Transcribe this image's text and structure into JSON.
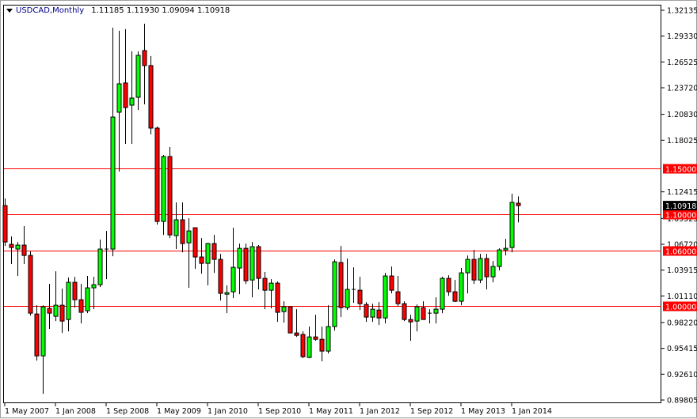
{
  "header": {
    "symbol": "USDCAD,Monthly",
    "open": "1.11185",
    "high": "1.11930",
    "low": "1.09094",
    "close": "1.10918"
  },
  "chart_data": {
    "type": "candlestick",
    "title": "USDCAD,Monthly",
    "first_month": "May 2007",
    "last_month": "Feb 2014",
    "ylim": [
      0.89805,
      1.32135
    ],
    "y_ticks": [
      "1.32135",
      "1.29330",
      "1.26525",
      "1.23720",
      "1.20830",
      "1.18025",
      "1.12415",
      "1.09525",
      "1.06720",
      "1.03915",
      "1.01110",
      "0.98220",
      "0.95415",
      "0.92610",
      "0.89805"
    ],
    "x_ticks": [
      "1 May 2007",
      "1 Jan 2008",
      "1 Sep 2008",
      "1 May 2009",
      "1 Jan 2010",
      "1 Sep 2010",
      "1 May 2011",
      "1 Jan 2012",
      "1 Sep 2012",
      "1 May 2013",
      "1 Jan 2014"
    ],
    "x_tick_every_months": 8,
    "horizontal_lines": [
      {
        "value": 1.15,
        "label": "1.15000"
      },
      {
        "value": 1.1,
        "label": "1.10000"
      },
      {
        "value": 1.06,
        "label": "1.06000"
      },
      {
        "value": 1.0,
        "label": "1.00000"
      }
    ],
    "current_price": {
      "value": 1.10918,
      "label": "1.10918"
    },
    "colors": {
      "up": "#00ff00",
      "down": "#ff0000",
      "line": "#ff0000",
      "outline": "#000000",
      "current": "#000000"
    },
    "ohlc": [
      [
        1.1092,
        1.1169,
        1.0654,
        1.0697
      ],
      [
        1.0671,
        1.0757,
        1.0457,
        1.0637
      ],
      [
        1.062,
        1.0697,
        1.0328,
        1.0663
      ],
      [
        1.0663,
        1.0869,
        1.0457,
        1.0551
      ],
      [
        1.0551,
        1.0594,
        0.9898,
        0.9924
      ],
      [
        0.9915,
        1.001,
        0.9409,
        0.946
      ],
      [
        0.946,
        1.001,
        0.9048,
        0.9993
      ],
      [
        0.9975,
        1.0242,
        0.9752,
        0.9924
      ],
      [
        0.989,
        1.0379,
        0.9838,
        1.001
      ],
      [
        1.001,
        1.019,
        0.9709,
        0.9838
      ],
      [
        0.9855,
        1.031,
        0.9726,
        1.0259
      ],
      [
        1.0259,
        1.0319,
        0.9984,
        1.007
      ],
      [
        1.007,
        1.0242,
        0.9812,
        0.9933
      ],
      [
        0.995,
        1.0328,
        0.9924,
        1.0199
      ],
      [
        1.0199,
        1.0319,
        0.9967,
        1.0233
      ],
      [
        1.0233,
        1.0723,
        1.0207,
        1.062
      ],
      [
        1.062,
        1.0817,
        1.0293,
        1.062
      ],
      [
        1.062,
        1.3025,
        1.0542,
        1.2054
      ],
      [
        1.2106,
        1.2991,
        1.1462,
        1.2415
      ],
      [
        1.2424,
        1.3008,
        1.1762,
        1.2157
      ],
      [
        1.2183,
        1.2767,
        1.1762,
        1.226
      ],
      [
        1.2269,
        1.2767,
        1.2132,
        1.2724
      ],
      [
        1.2776,
        1.3068,
        1.2192,
        1.2613
      ],
      [
        1.2613,
        1.2716,
        1.1865,
        1.1934
      ],
      [
        1.1934,
        1.1951,
        1.0886,
        1.092
      ],
      [
        1.092,
        1.1642,
        1.0774,
        1.1625
      ],
      [
        1.1625,
        1.1728,
        1.074,
        1.0774
      ],
      [
        1.0766,
        1.1127,
        1.062,
        1.0938
      ],
      [
        1.0938,
        1.1127,
        1.0585,
        1.068
      ],
      [
        1.0688,
        1.0955,
        1.0199,
        1.0817
      ],
      [
        1.0852,
        1.0852,
        1.0405,
        1.0534
      ],
      [
        1.0534,
        1.074,
        1.0353,
        1.0465
      ],
      [
        1.0465,
        1.0688,
        1.0225,
        1.068
      ],
      [
        1.068,
        1.0774,
        1.0362,
        1.0508
      ],
      [
        1.0508,
        1.0568,
        1.0061,
        1.0139
      ],
      [
        1.013,
        1.0225,
        0.9924,
        1.0147
      ],
      [
        1.0156,
        1.0852,
        1.0087,
        1.0422
      ],
      [
        1.0414,
        1.068,
        1.013,
        1.0628
      ],
      [
        1.0628,
        1.068,
        1.0242,
        1.0276
      ],
      [
        1.0284,
        1.0697,
        1.0096,
        1.0646
      ],
      [
        1.0646,
        1.0663,
        1.0182,
        1.0302
      ],
      [
        1.0302,
        1.0371,
        0.9967,
        1.0173
      ],
      [
        1.0173,
        1.0293,
        0.9975,
        1.025
      ],
      [
        1.025,
        1.0268,
        0.9829,
        0.9933
      ],
      [
        0.9941,
        1.0053,
        0.9821,
        0.9993
      ],
      [
        0.9993,
        0.9993,
        0.9709,
        0.9709
      ],
      [
        0.9709,
        0.9967,
        0.9666,
        0.9683
      ],
      [
        0.9692,
        0.9726,
        0.9434,
        0.9451
      ],
      [
        0.9443,
        0.9778,
        0.9434,
        0.9666
      ],
      [
        0.9666,
        0.9907,
        0.9623,
        0.964
      ],
      [
        0.964,
        0.9778,
        0.94,
        0.9512
      ],
      [
        0.9512,
        1.001,
        0.9486,
        0.9778
      ],
      [
        0.9778,
        1.0508,
        0.9735,
        1.0482
      ],
      [
        1.0474,
        1.0654,
        0.9881,
        0.9984
      ],
      [
        0.9984,
        1.0517,
        0.9958,
        1.0182
      ],
      [
        1.0182,
        1.0422,
        1.0036,
        1.0182
      ],
      [
        1.0173,
        1.0319,
        0.9958,
        1.0027
      ],
      [
        1.0018,
        1.0044,
        0.9829,
        0.9881
      ],
      [
        0.9881,
        1.0027,
        0.9829,
        0.9967
      ],
      [
        0.9958,
        1.0044,
        0.9795,
        0.9872
      ],
      [
        0.9872,
        1.0362,
        0.9812,
        1.0328
      ],
      [
        1.0328,
        1.0431,
        1.0139,
        1.0173
      ],
      [
        1.0156,
        1.0328,
        1.0001,
        1.0027
      ],
      [
        1.0027,
        1.0053,
        0.9838,
        0.9855
      ],
      [
        0.9855,
        0.9907,
        0.9623,
        0.9829
      ],
      [
        0.9838,
        1.0018,
        0.9726,
        0.9993
      ],
      [
        0.9984,
        1.0053,
        0.9855,
        0.9855
      ],
      [
        0.9924,
        0.9967,
        0.9812,
        0.9924
      ],
      [
        0.9924,
        1.0096,
        0.9812,
        0.9967
      ],
      [
        0.9967,
        1.0319,
        0.9924,
        1.0302
      ],
      [
        1.0302,
        1.0336,
        1.0113,
        1.0156
      ],
      [
        1.0156,
        1.0284,
        1.0044,
        1.0053
      ],
      [
        1.0053,
        1.0414,
        1.001,
        1.0362
      ],
      [
        1.0362,
        1.0551,
        1.0139,
        1.0508
      ],
      [
        1.0508,
        1.0611,
        1.0242,
        1.0284
      ],
      [
        1.0284,
        1.0568,
        1.025,
        1.0517
      ],
      [
        1.0517,
        1.0568,
        1.0182,
        1.0319
      ],
      [
        1.0319,
        1.0491,
        1.0259,
        1.0431
      ],
      [
        1.0431,
        1.0628,
        1.0388,
        1.0611
      ],
      [
        1.0611,
        1.0731,
        1.0551,
        1.0628
      ],
      [
        1.0637,
        1.1221,
        1.0585,
        1.1127
      ],
      [
        1.11185,
        1.1193,
        1.09094,
        1.10918
      ]
    ]
  }
}
